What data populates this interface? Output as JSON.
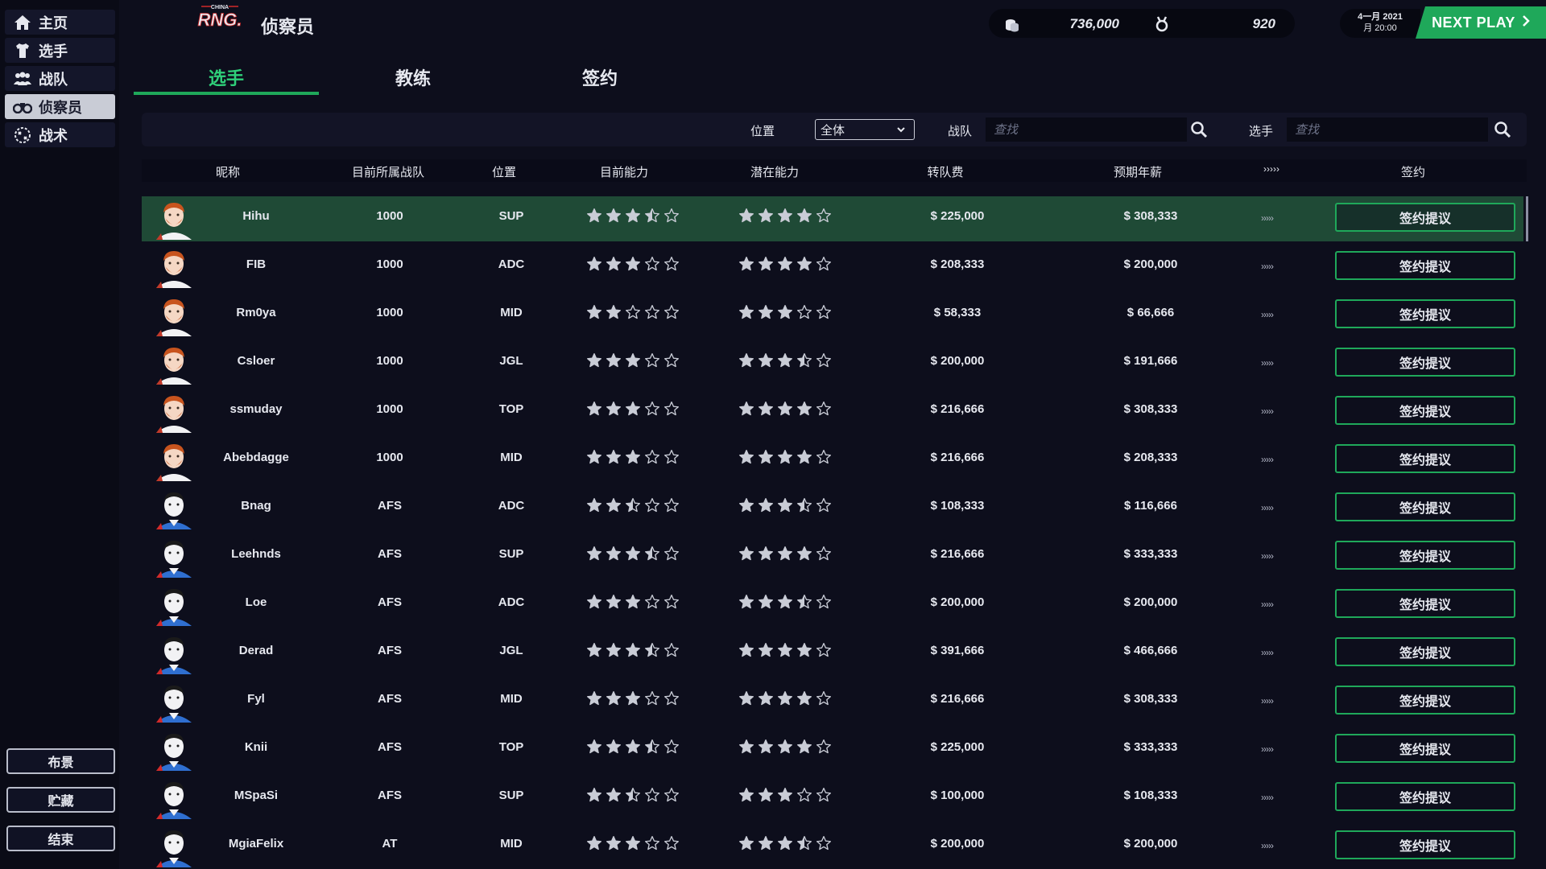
{
  "sidebar": {
    "items": [
      {
        "label": "主页",
        "icon": "home-icon"
      },
      {
        "label": "选手",
        "icon": "shirt-icon"
      },
      {
        "label": "战队",
        "icon": "team-icon"
      },
      {
        "label": "侦察员",
        "icon": "binoculars-icon"
      },
      {
        "label": "战术",
        "icon": "tactics-icon"
      }
    ],
    "active_index": 3,
    "bottom_buttons": [
      "布景",
      "贮藏",
      "结束"
    ]
  },
  "header": {
    "logo_top": "CHINA",
    "logo_text": "RNG.",
    "title": "侦察员",
    "money": "736,000",
    "fans": "920",
    "date_line1": "4一月 2021",
    "date_line2": "月 20:00",
    "next_play": "NEXT PLAY"
  },
  "tabs": [
    {
      "label": "选手",
      "active": true
    },
    {
      "label": "教练",
      "active": false
    },
    {
      "label": "签约",
      "active": false
    }
  ],
  "filters": {
    "position_label": "位置",
    "position_value": "全体",
    "team_label": "战队",
    "team_placeholder": "查找",
    "player_label": "选手",
    "player_placeholder": "查找"
  },
  "table": {
    "headers": {
      "nickname": "昵称",
      "team": "目前所属战队",
      "position": "位置",
      "ability": "目前能力",
      "potential": "潜在能力",
      "fee": "转队费",
      "salary": "预期年薪",
      "more": "›››››",
      "sign": "签约"
    },
    "sign_label": "签约提议",
    "more_label": "›››››",
    "rows": [
      {
        "name": "Hihu",
        "team": "1000",
        "pos": "SUP",
        "ability": 3.5,
        "potential": 4,
        "fee": "$ 225,000",
        "salary": "$ 308,333",
        "avatar": "orange",
        "selected": true
      },
      {
        "name": "FIB",
        "team": "1000",
        "pos": "ADC",
        "ability": 3,
        "potential": 4,
        "fee": "$ 208,333",
        "salary": "$ 200,000",
        "avatar": "orange"
      },
      {
        "name": "Rm0ya",
        "team": "1000",
        "pos": "MID",
        "ability": 2,
        "potential": 3,
        "fee": "$ 58,333",
        "salary": "$ 66,666",
        "avatar": "orange"
      },
      {
        "name": "Csloer",
        "team": "1000",
        "pos": "JGL",
        "ability": 3,
        "potential": 3.5,
        "fee": "$ 200,000",
        "salary": "$ 191,666",
        "avatar": "orange"
      },
      {
        "name": "ssmuday",
        "team": "1000",
        "pos": "TOP",
        "ability": 3,
        "potential": 4,
        "fee": "$ 216,666",
        "salary": "$ 308,333",
        "avatar": "orange"
      },
      {
        "name": "Abebdagge",
        "team": "1000",
        "pos": "MID",
        "ability": 3,
        "potential": 4,
        "fee": "$ 216,666",
        "salary": "$ 208,333",
        "avatar": "orange"
      },
      {
        "name": "Bnag",
        "team": "AFS",
        "pos": "ADC",
        "ability": 2.5,
        "potential": 3.5,
        "fee": "$ 108,333",
        "salary": "$ 116,666",
        "avatar": "blue"
      },
      {
        "name": "Leehnds",
        "team": "AFS",
        "pos": "SUP",
        "ability": 3.5,
        "potential": 4,
        "fee": "$ 216,666",
        "salary": "$ 333,333",
        "avatar": "blue"
      },
      {
        "name": "Loe",
        "team": "AFS",
        "pos": "ADC",
        "ability": 3,
        "potential": 3.5,
        "fee": "$ 200,000",
        "salary": "$ 200,000",
        "avatar": "blue"
      },
      {
        "name": "Derad",
        "team": "AFS",
        "pos": "JGL",
        "ability": 3.5,
        "potential": 4,
        "fee": "$ 391,666",
        "salary": "$ 466,666",
        "avatar": "blue"
      },
      {
        "name": "Fyl",
        "team": "AFS",
        "pos": "MID",
        "ability": 3,
        "potential": 4,
        "fee": "$ 216,666",
        "salary": "$ 308,333",
        "avatar": "blue"
      },
      {
        "name": "Knii",
        "team": "AFS",
        "pos": "TOP",
        "ability": 3.5,
        "potential": 4,
        "fee": "$ 225,000",
        "salary": "$ 333,333",
        "avatar": "blue"
      },
      {
        "name": "MSpaSi",
        "team": "AFS",
        "pos": "SUP",
        "ability": 2.5,
        "potential": 3,
        "fee": "$ 100,000",
        "salary": "$ 108,333",
        "avatar": "blue"
      },
      {
        "name": "MgiaFelix",
        "team": "AT",
        "pos": "MID",
        "ability": 3,
        "potential": 3.5,
        "fee": "$ 200,000",
        "salary": "$ 200,000",
        "avatar": "blue"
      }
    ]
  },
  "colors": {
    "accent": "#1fa85a",
    "selected_row": "#1f4a36",
    "background": "#0d0e1c",
    "star": "#c9ccd6"
  }
}
